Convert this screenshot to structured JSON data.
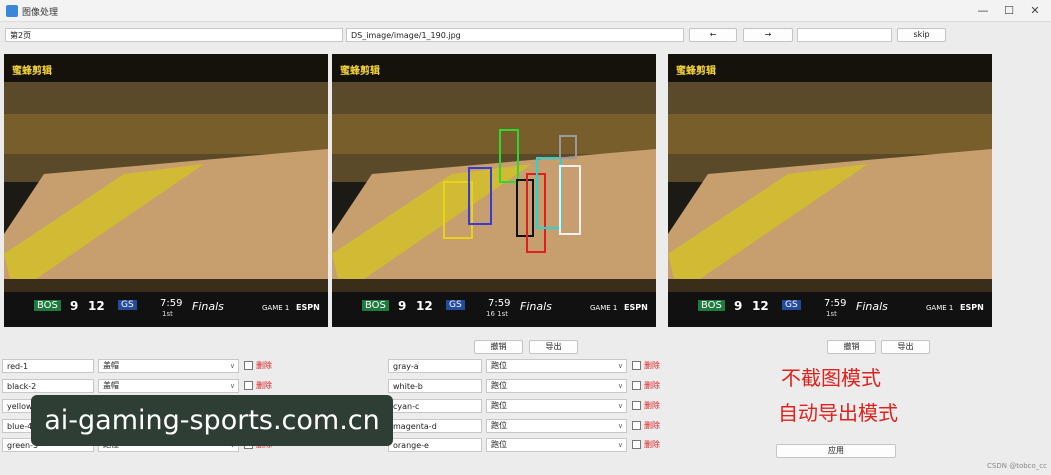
{
  "window": {
    "title": "图像处理"
  },
  "toolbar": {
    "page_label": "第2页",
    "path": "DS_image/image/1_190.jpg",
    "prev": "←",
    "next": "→",
    "jump_value": "",
    "skip": "skip"
  },
  "scoreboard": {
    "brand": "蜜蜂剪辑",
    "home_team": "BOS",
    "home_score": "9",
    "away_score": "12",
    "away_team": "GS",
    "clock": "7:59",
    "period": "1st",
    "period_alt": "16  1st",
    "finals": "Finals",
    "game": "GAME 1",
    "network": "ESPN"
  },
  "boxes_colors": {
    "yellow": "#e8d21a",
    "blue": "#3a3ad8",
    "green": "#2ed82e",
    "black": "#111111",
    "red": "#e02020",
    "cyan": "#25d6d6",
    "white": "#f2f2f2",
    "gray": "#9a9a9a"
  },
  "mid_actions": {
    "undo": "撤销",
    "export": "导出"
  },
  "right_actions": {
    "undo": "撤销",
    "export": "导出",
    "apply": "应用"
  },
  "left_rows": [
    {
      "name": "red-1",
      "action": "盖帽",
      "delete": "删除"
    },
    {
      "name": "black-2",
      "action": "盖帽",
      "delete": "删除"
    },
    {
      "name": "yellow-3",
      "action": "盖帽",
      "delete": "删除"
    },
    {
      "name": "blue-4",
      "action": "盖帽",
      "delete": "删除"
    },
    {
      "name": "green-5",
      "action": "跑位",
      "delete": "删除"
    }
  ],
  "mid_rows": [
    {
      "name": "gray-a",
      "action": "跑位",
      "delete": "删除"
    },
    {
      "name": "white-b",
      "action": "跑位",
      "delete": "删除"
    },
    {
      "name": "cyan-c",
      "action": "跑位",
      "delete": "删除"
    },
    {
      "name": "magenta-d",
      "action": "跑位",
      "delete": "删除"
    },
    {
      "name": "orange-e",
      "action": "跑位",
      "delete": "删除"
    }
  ],
  "notes": {
    "line1": "不截图模式",
    "line2": "自动导出模式"
  },
  "watermark": "ai-gaming-sports.com.cn",
  "credit": "CSDN @tobco_cc"
}
